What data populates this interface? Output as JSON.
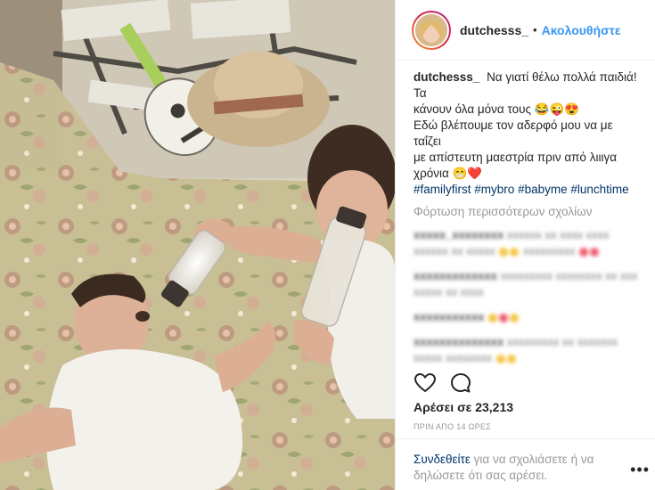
{
  "post": {
    "username": "dutchesss_",
    "follow_dot": "•",
    "follow_label": "Ακολουθήστε",
    "caption_user": "dutchesss_",
    "caption_line1": "Να γιατί θέλω πολλά παιδιά! Τα",
    "caption_line2": "κάνουν όλα μόνα τους 😂😜😍",
    "caption_line3": "Εδώ βλέπουμε τον αδερφό μου να με ταΐζει",
    "caption_line4": "με απίστευτη μαεστρία πριν από λιιιγα",
    "caption_line5": "χρόνια 😁❤️",
    "hashtags": [
      "#familyfirst",
      "#mybro",
      "#babyme",
      "#lunchtime"
    ],
    "load_more": "Φόρτωση περισσότερων σχολίων",
    "likes": "Αρέσει σε 23,213",
    "timestamp": "ΠΡΙΝ ΑΠΟ 14 ΩΡΕΣ",
    "login_link": "Συνδεθείτε",
    "login_rest": " για να σχολιάσετε ή να δηλώσετε ότι σας αρέσει.",
    "more_label": "•••"
  },
  "icons": {
    "like": "heart-icon",
    "comment": "comment-icon",
    "more": "more-options-icon"
  },
  "colors": {
    "link_blue": "#3897f0",
    "hashtag_navy": "#003569",
    "muted_gray": "#999999"
  }
}
